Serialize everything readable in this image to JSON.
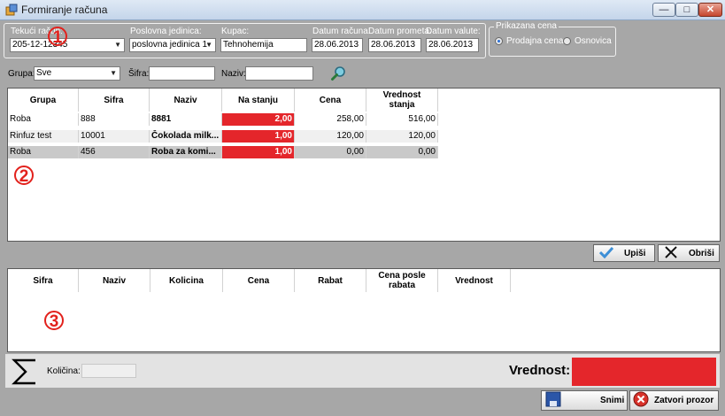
{
  "window": {
    "title": "Formiranje računa",
    "min": "—",
    "max": "□",
    "close": "✕"
  },
  "header": {
    "current_invoice_label": "Tekući račun:",
    "current_invoice_value": "205-12-12345",
    "unit_label": "Poslovna jedinica:",
    "unit_value": "poslovna jedinica 1",
    "customer_label": "Kupac:",
    "customer_value": "Tehnohemija",
    "invoice_date_label": "Datum računa:",
    "invoice_date_value": "28.06.2013",
    "turnover_date_label": "Datum prometa:",
    "turnover_date_value": "28.06.2013",
    "currency_date_label": "Datum valute:",
    "currency_date_value": "28.06.2013"
  },
  "price_display": {
    "legend": "Prikazana cena",
    "option_sale": "Prodajna cena",
    "option_base": "Osnovica",
    "selected": "Prodajna cena"
  },
  "filters": {
    "group_label": "Grupa:",
    "group_value": "Sve",
    "code_label": "Šifra:",
    "code_value": "",
    "name_label": "Naziv:",
    "name_value": ""
  },
  "markers": {
    "one": "1",
    "two": "2",
    "three": "3"
  },
  "products": {
    "columns": [
      "Grupa",
      "Sifra",
      "Naziv",
      "Na stanju",
      "Cena",
      "Vrednost stanja"
    ],
    "rows": [
      [
        "Roba",
        "888",
        "8881",
        "2,00",
        "258,00",
        "516,00"
      ],
      [
        "Rinfuz test",
        "10001",
        "Čokolada milk...",
        "1,00",
        "120,00",
        "120,00"
      ],
      [
        "Roba",
        "456",
        "Roba za komi...",
        "1,00",
        "0,00",
        "0,00"
      ]
    ]
  },
  "actions": {
    "write": "Upiši",
    "delete": "Obriši"
  },
  "items": {
    "columns": [
      "Sifra",
      "Naziv",
      "Kolicina",
      "Cena",
      "Rabat",
      "Cena posle rabata",
      "Vrednost"
    ]
  },
  "footer": {
    "quantity_label": "Količina:",
    "quantity_value": "",
    "value_label": "Vrednost:",
    "save": "Snimi",
    "close": "Zatvori prozor"
  },
  "colors": {
    "stock_highlight": "#e4262b",
    "marker": "#e2211c",
    "window_bg": "#a7a7a7"
  }
}
